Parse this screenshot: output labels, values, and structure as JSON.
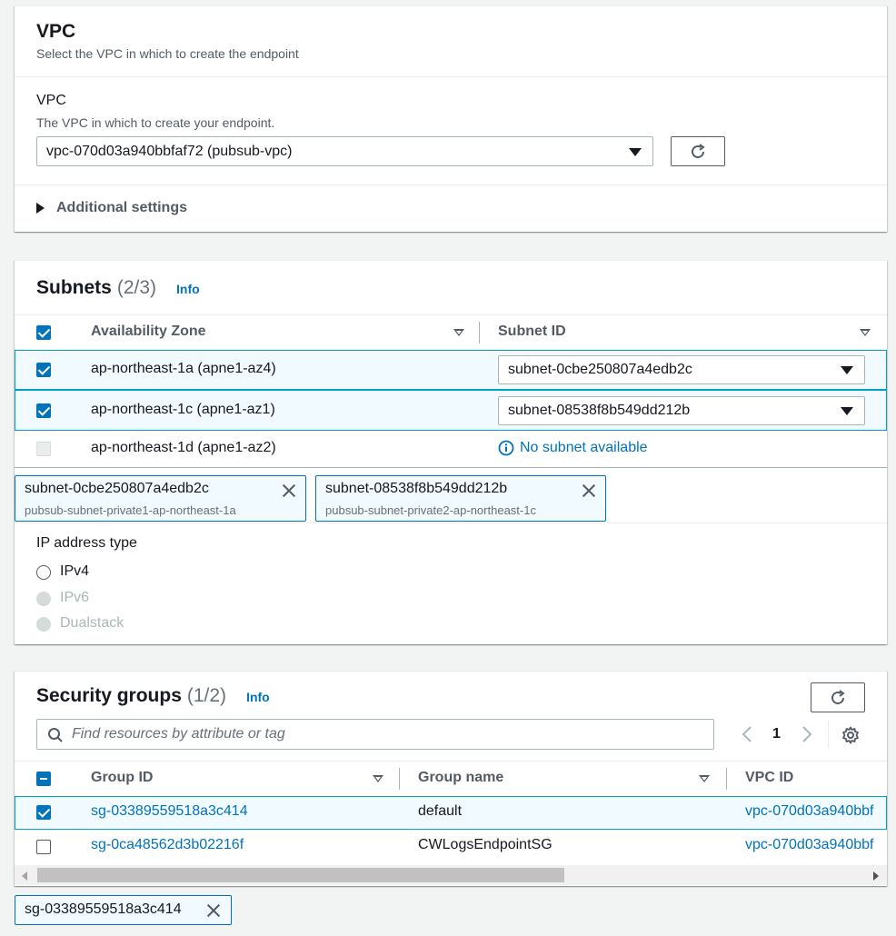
{
  "vpc_panel": {
    "title": "VPC",
    "description": "Select the VPC in which to create the endpoint",
    "field_label": "VPC",
    "field_description": "The VPC in which to create your endpoint.",
    "selected_vpc": "vpc-070d03a940bbfaf72 (pubsub-vpc)",
    "additional_settings": "Additional settings"
  },
  "subnets_panel": {
    "title": "Subnets",
    "count": "(2/3)",
    "info": "Info",
    "columns": [
      "Availability Zone",
      "Subnet ID"
    ],
    "rows": [
      {
        "zone": "ap-northeast-1a (apne1-az4)",
        "subnet": "subnet-0cbe250807a4edb2c",
        "checked": true
      },
      {
        "zone": "ap-northeast-1c (apne1-az1)",
        "subnet": "subnet-08538f8b549dd212b",
        "checked": true
      },
      {
        "zone": "ap-northeast-1d (apne1-az2)",
        "subnet": "No subnet available",
        "checked": false
      }
    ],
    "tokens": [
      {
        "id": "subnet-0cbe250807a4edb2c",
        "name": "pubsub-subnet-private1-ap-northeast-1a"
      },
      {
        "id": "subnet-08538f8b549dd212b",
        "name": "pubsub-subnet-private2-ap-northeast-1c"
      }
    ],
    "ip_type_label": "IP address type",
    "ip_options": [
      "IPv4",
      "IPv6",
      "Dualstack"
    ]
  },
  "sg_panel": {
    "title": "Security groups",
    "count": "(1/2)",
    "info": "Info",
    "search_placeholder": "Find resources by attribute or tag",
    "page": "1",
    "columns": [
      "Group ID",
      "Group name",
      "VPC ID"
    ],
    "rows": [
      {
        "group_id": "sg-03389559518a3c414",
        "group_name": "default",
        "vpc_id": "vpc-070d03a940bbf",
        "checked": true
      },
      {
        "group_id": "sg-0ca48562d3b02216f",
        "group_name": "CWLogsEndpointSG",
        "vpc_id": "vpc-070d03a940bbf",
        "checked": false
      }
    ],
    "token": "sg-03389559518a3c414"
  },
  "colors": {
    "accent": "#0073bb",
    "selected_row_bg": "#f1faff",
    "selected_row_border": "#00a1c9",
    "page_bg": "#f2f3f3"
  }
}
